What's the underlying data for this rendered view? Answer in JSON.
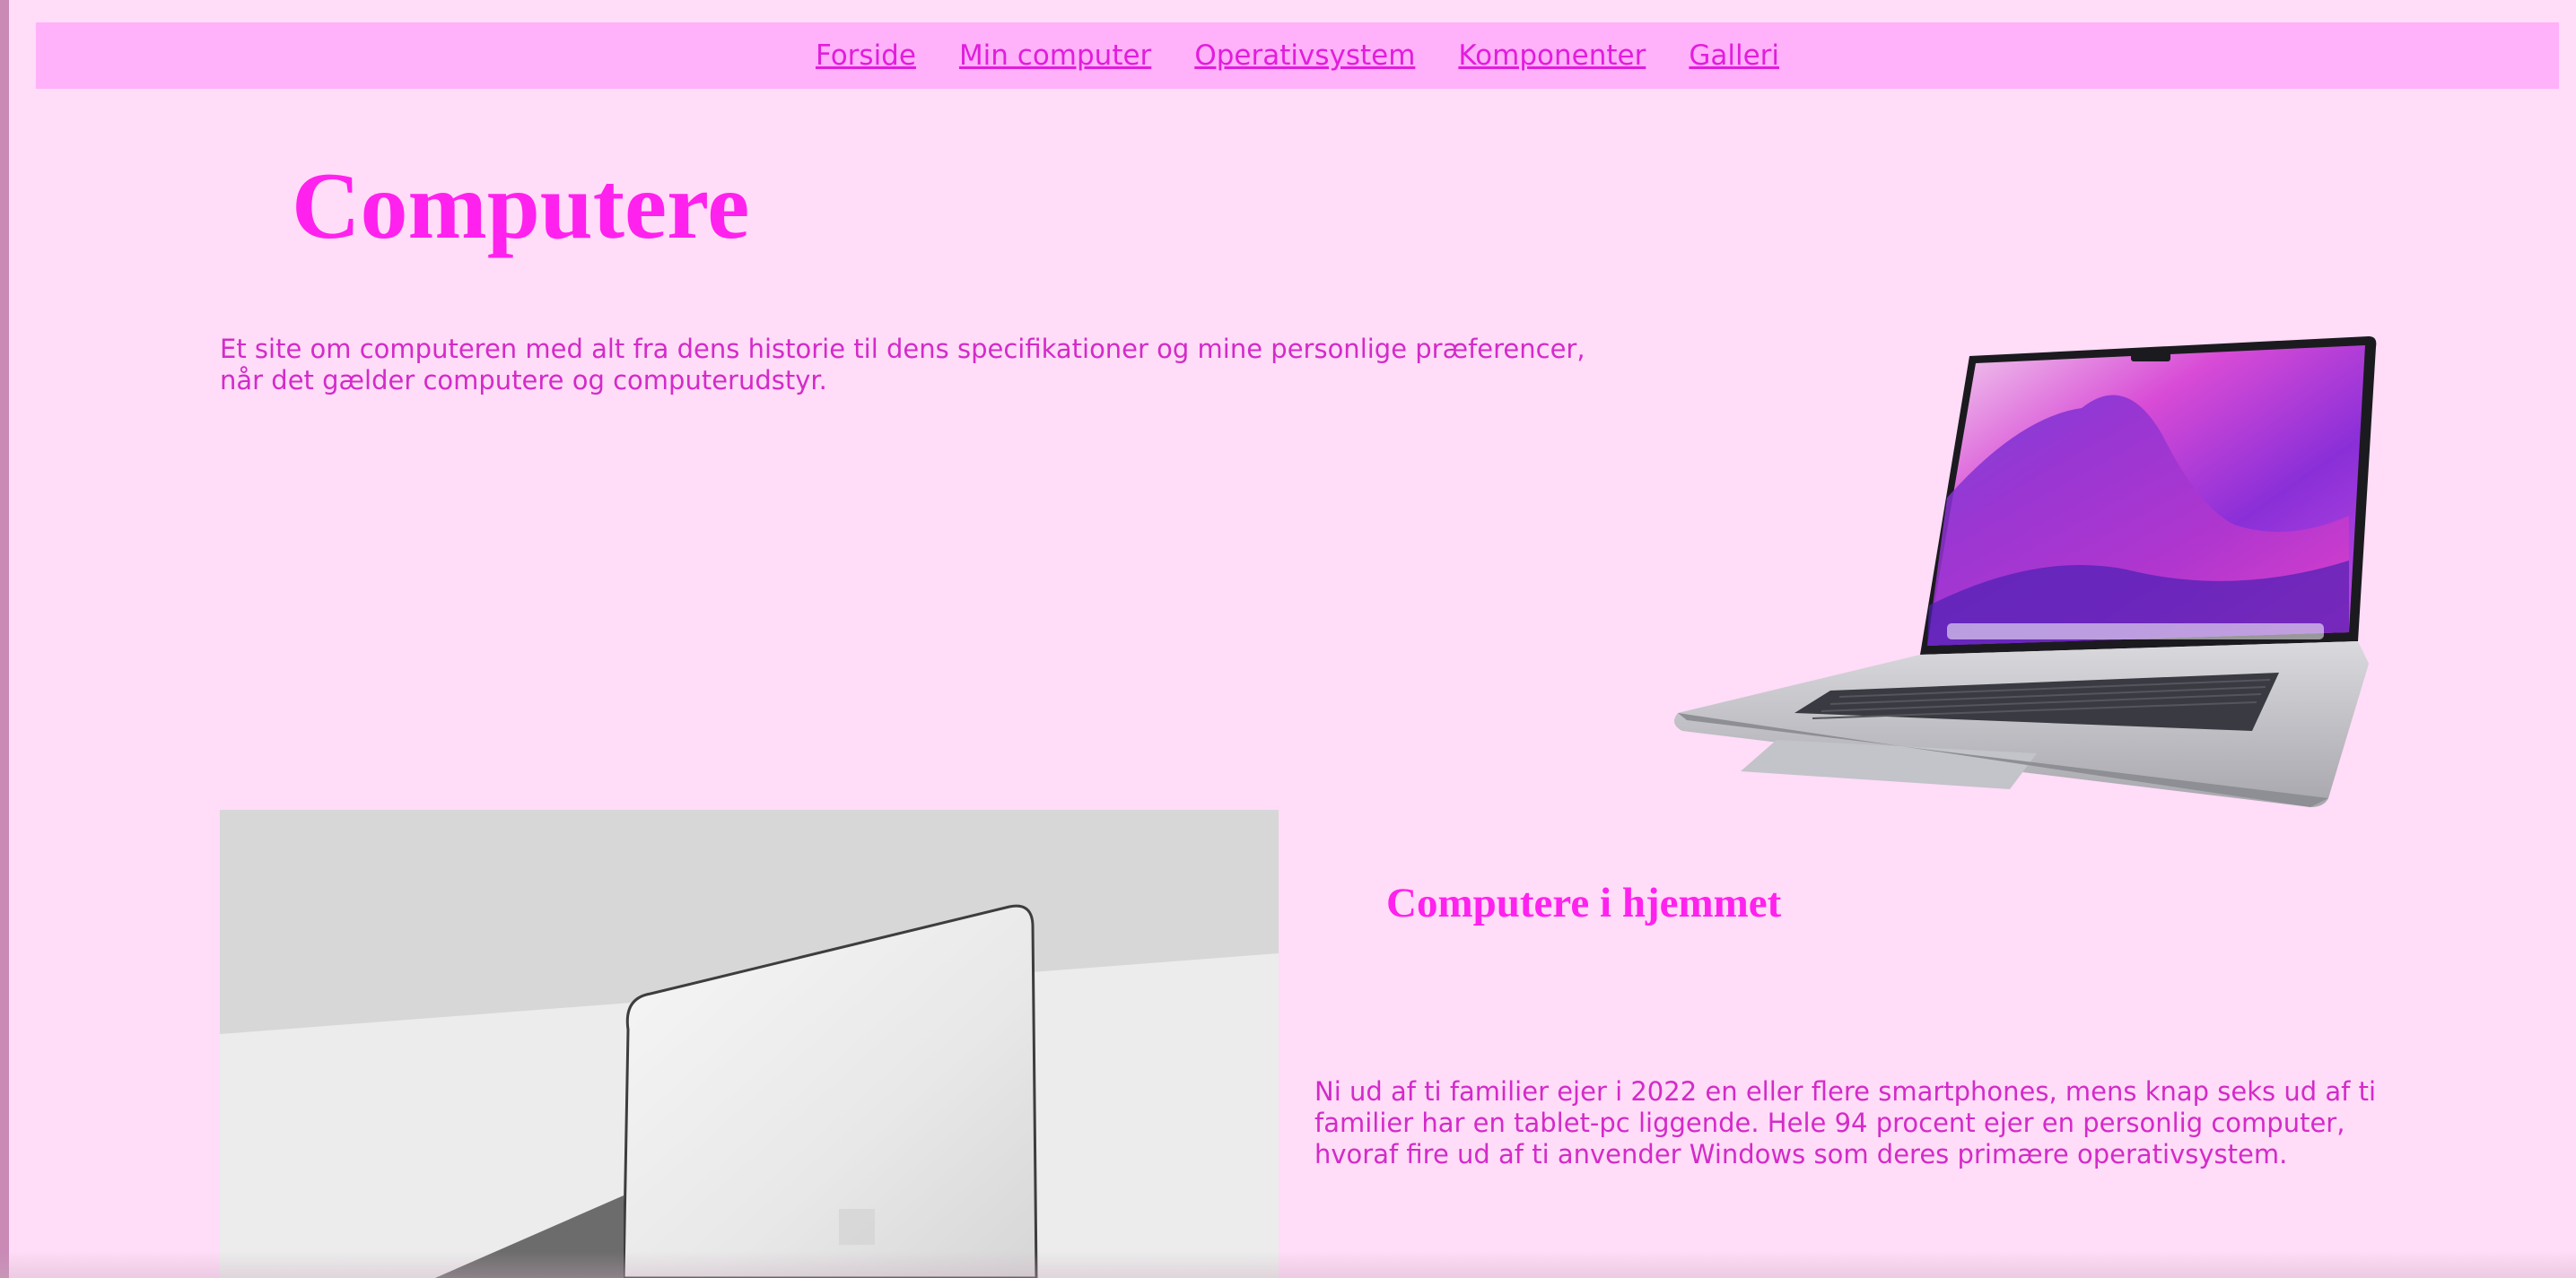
{
  "nav": {
    "items": [
      {
        "label": "Forside"
      },
      {
        "label": "Min computer"
      },
      {
        "label": "Operativsystem"
      },
      {
        "label": "Komponenter"
      },
      {
        "label": "Galleri"
      }
    ]
  },
  "header": {
    "title": "Computere",
    "intro": "Et site om computeren med alt fra dens historie til dens specifikationer og mine personlige præferencer, når det gælder computere og computerudstyr."
  },
  "section": {
    "title": "Computere i hjemmet",
    "text": "Ni ud af ti familier ejer i 2022 en eller flere smartphones, mens knap seks ud af ti familier har en tablet-pc liggende. Hele 94 procent ejer en personlig computer, hvoraf fire ud af ti anvender Windows som deres primære operativsystem."
  },
  "colors": {
    "page_background": "#ffdcf7",
    "nav_background": "#ffb1f9",
    "accent": "#ff21ee",
    "body_text": "#d32bc9"
  },
  "images": {
    "hero_laptop": "laptop-illustration",
    "surface_laptop_photo": "laptop-photo"
  }
}
